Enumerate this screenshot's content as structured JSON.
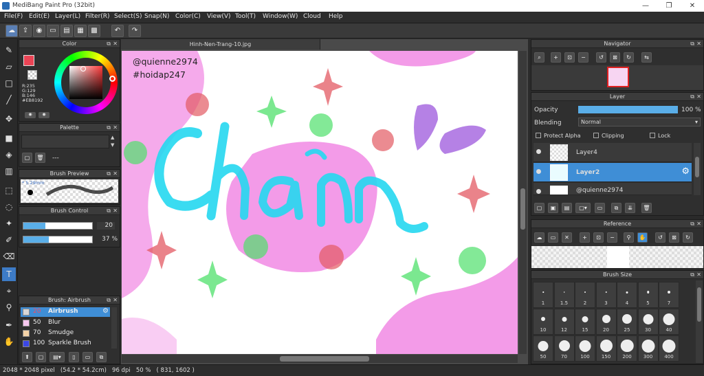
{
  "window": {
    "title": "MediBang Paint Pro (32bit)",
    "minimize": "—",
    "maximize": "❐",
    "close": "✕"
  },
  "menu": [
    "File(F)",
    "Edit(E)",
    "Layer(L)",
    "Filter(R)",
    "Select(S)",
    "Snap(N)",
    "Color(C)",
    "View(V)",
    "Tool(T)",
    "Window(W)",
    "Cloud",
    "Help"
  ],
  "color_panel": {
    "title": "Color",
    "r": "R:235",
    "g": "G:129",
    "b": "B:146",
    "hex": "#EB8192",
    "primary_color": "#eb4455"
  },
  "palette_panel": {
    "title": "Palette",
    "empty": "---"
  },
  "brush_preview_panel": {
    "title": "Brush Preview",
    "size": "5.29mm"
  },
  "brush_control_panel": {
    "title": "Brush Control",
    "size_value": "20",
    "opacity_value": "37 %",
    "size_fraction": 0.32,
    "opacity_fraction": 0.37
  },
  "brush_list_panel": {
    "title": "Brush: Airbrush",
    "items": [
      {
        "size": "20",
        "name": "Airbrush",
        "color": "#d7d7d7"
      },
      {
        "size": "50",
        "name": "Blur",
        "color": "#f6c7ef"
      },
      {
        "size": "70",
        "name": "Smudge",
        "color": "#f4d3a7"
      },
      {
        "size": "100",
        "name": "Sparkle Brush",
        "color": "#3b47e6"
      }
    ]
  },
  "document": {
    "tab": "Hinh-Nen-Trang-10.jpg",
    "watermark1": "@quienne2974",
    "watermark2": "#hoidap247"
  },
  "navigator": {
    "title": "Navigator"
  },
  "layer_panel": {
    "title": "Layer",
    "opacity_label": "Opacity",
    "opacity_value": "100 %",
    "opacity_fraction": 1.0,
    "blending_label": "Blending",
    "blending_value": "Normal",
    "protect_alpha": "Protect Alpha",
    "clipping": "Clipping",
    "lock": "Lock",
    "layers": [
      {
        "name": "Layer4"
      },
      {
        "name": "Layer2"
      },
      {
        "name": "@quienne2974"
      }
    ]
  },
  "reference_panel": {
    "title": "Reference"
  },
  "brush_size_panel": {
    "title": "Brush Size",
    "sizes": [
      "1",
      "1.5",
      "2",
      "3",
      "4",
      "5",
      "7",
      "10",
      "12",
      "15",
      "20",
      "25",
      "30",
      "40",
      "50",
      "70",
      "100",
      "150",
      "200",
      "300",
      "400"
    ]
  },
  "status": {
    "text": "2048 * 2048 pixel   (54.2 * 54.2cm)   96 dpi   50 %   ( 831, 1602 )"
  }
}
